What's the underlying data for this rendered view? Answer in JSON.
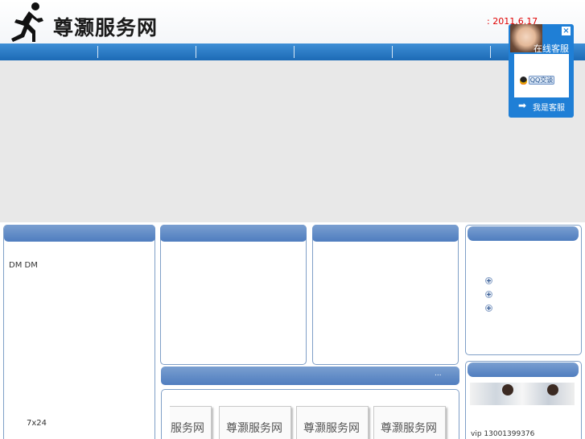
{
  "header": {
    "site_name": "尊灏服务网",
    "date": ": 2011.6.17"
  },
  "column1": {
    "text": "DM   DM",
    "footer": "7x24"
  },
  "partners": {
    "more": "...",
    "logos": [
      "服务网",
      "尊灏服务网",
      "尊灏服务网",
      "尊灏服务网"
    ]
  },
  "service": {
    "contact": "vip       13001399376"
  },
  "floating_panel": {
    "title": "在线客服",
    "qq_button": "QQ交谈",
    "footer": "我是客服",
    "close_icon": "close-icon"
  },
  "colors": {
    "nav_bar": "#1c6ab5",
    "box_header": "#5f88c4",
    "date_red": "#e00000",
    "panel_blue": "#1f7fd6"
  }
}
